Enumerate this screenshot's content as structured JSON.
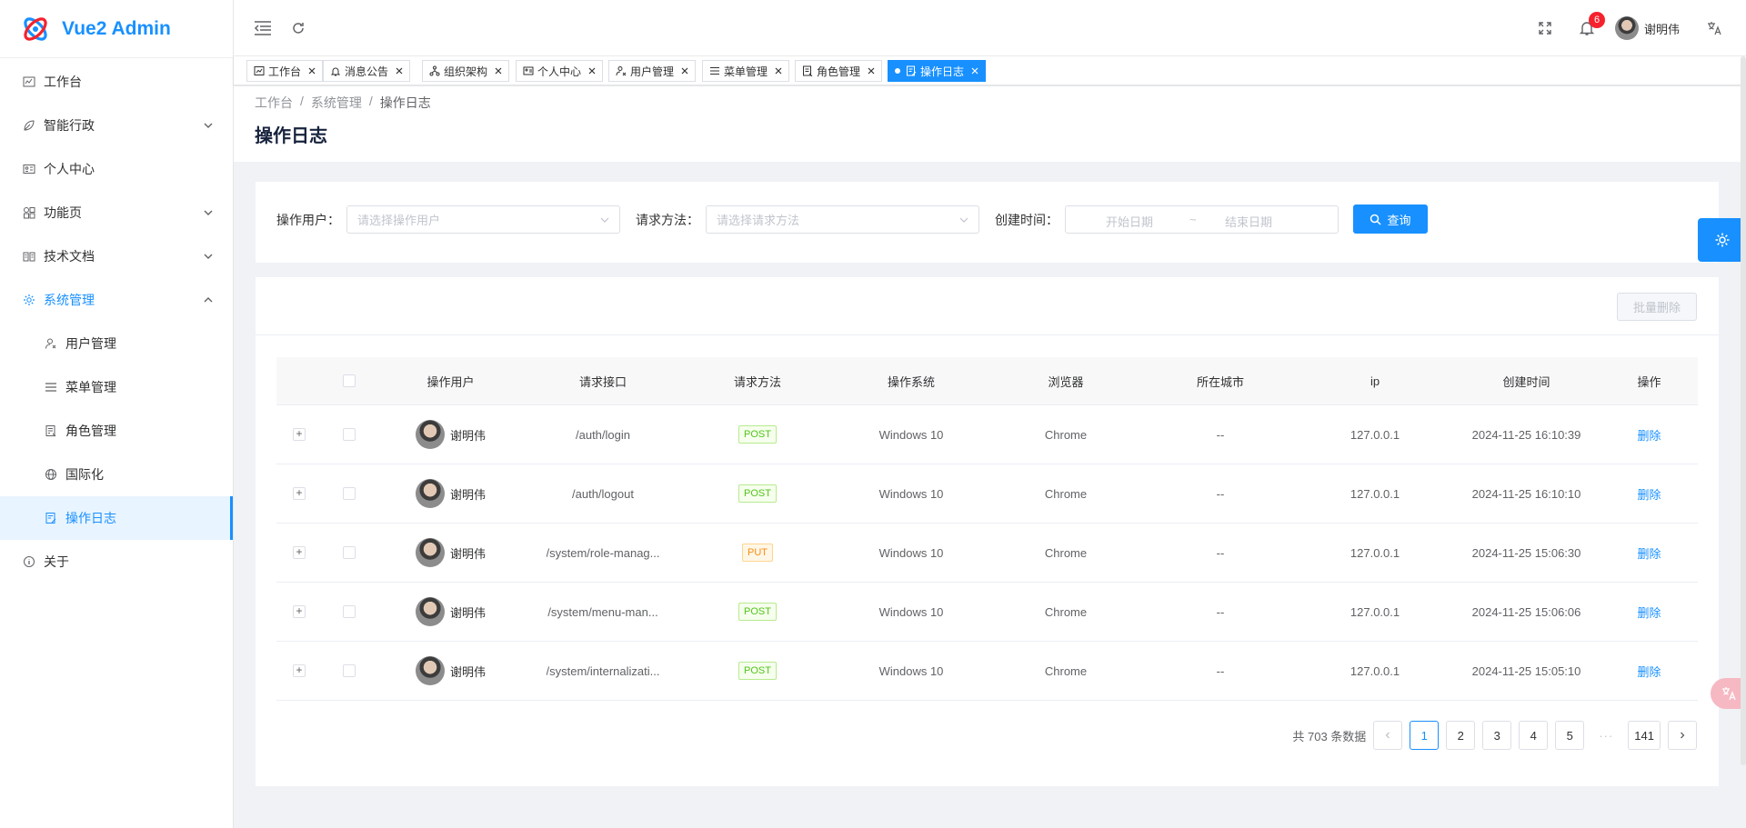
{
  "app": {
    "title": "Vue2 Admin"
  },
  "sidebar": {
    "items": [
      {
        "label": "工作台",
        "icon": "dashboard-icon"
      },
      {
        "label": "智能行政",
        "icon": "leaf-icon",
        "expandable": true
      },
      {
        "label": "个人中心",
        "icon": "id-card-icon"
      },
      {
        "label": "功能页",
        "icon": "apps-icon",
        "expandable": true
      },
      {
        "label": "技术文档",
        "icon": "book-icon",
        "expandable": true
      },
      {
        "label": "系统管理",
        "icon": "gear-icon",
        "expandable": true,
        "expanded": true
      }
    ],
    "sub_items": [
      {
        "label": "用户管理",
        "icon": "users-icon"
      },
      {
        "label": "菜单管理",
        "icon": "menu-icon"
      },
      {
        "label": "角色管理",
        "icon": "role-icon"
      },
      {
        "label": "国际化",
        "icon": "globe-icon"
      },
      {
        "label": "操作日志",
        "icon": "log-icon",
        "selected": true
      }
    ],
    "about": {
      "label": "关于",
      "icon": "info-icon"
    }
  },
  "header": {
    "notification_count": "6",
    "user_name": "谢明伟"
  },
  "tabs": [
    {
      "label": "工作台"
    },
    {
      "label": "消息公告"
    },
    {
      "label": "组织架构"
    },
    {
      "label": "个人中心"
    },
    {
      "label": "用户管理"
    },
    {
      "label": "菜单管理"
    },
    {
      "label": "角色管理"
    },
    {
      "label": "操作日志",
      "active": true
    }
  ],
  "breadcrumb": [
    "工作台",
    "系统管理",
    "操作日志"
  ],
  "page_title": "操作日志",
  "search": {
    "user_label": "操作用户：",
    "user_placeholder": "请选择操作用户",
    "method_label": "请求方法：",
    "method_placeholder": "请选择请求方法",
    "time_label": "创建时间：",
    "start_placeholder": "开始日期",
    "range_sep": "~",
    "end_placeholder": "结束日期",
    "query_button": "查询"
  },
  "toolbar": {
    "batch_delete": "批量删除"
  },
  "table": {
    "columns": [
      "操作用户",
      "请求接口",
      "请求方法",
      "操作系统",
      "浏览器",
      "所在城市",
      "ip",
      "创建时间",
      "操作"
    ],
    "rows": [
      {
        "user": "谢明伟",
        "api": "/auth/login",
        "method": "POST",
        "os": "Windows 10",
        "browser": "Chrome",
        "city": "--",
        "ip": "127.0.0.1",
        "time": "2024-11-25 16:10:39",
        "op": "删除"
      },
      {
        "user": "谢明伟",
        "api": "/auth/logout",
        "method": "POST",
        "os": "Windows 10",
        "browser": "Chrome",
        "city": "--",
        "ip": "127.0.0.1",
        "time": "2024-11-25 16:10:10",
        "op": "删除"
      },
      {
        "user": "谢明伟",
        "api": "/system/role-manag...",
        "method": "PUT",
        "os": "Windows 10",
        "browser": "Chrome",
        "city": "--",
        "ip": "127.0.0.1",
        "time": "2024-11-25 15:06:30",
        "op": "删除"
      },
      {
        "user": "谢明伟",
        "api": "/system/menu-man...",
        "method": "POST",
        "os": "Windows 10",
        "browser": "Chrome",
        "city": "--",
        "ip": "127.0.0.1",
        "time": "2024-11-25 15:06:06",
        "op": "删除"
      },
      {
        "user": "谢明伟",
        "api": "/system/internalizati...",
        "method": "POST",
        "os": "Windows 10",
        "browser": "Chrome",
        "city": "--",
        "ip": "127.0.0.1",
        "time": "2024-11-25 15:05:10",
        "op": "删除"
      }
    ]
  },
  "pagination": {
    "total_text": "共 703 条数据",
    "pages": [
      "1",
      "2",
      "3",
      "4",
      "5"
    ],
    "current": "1",
    "ellipsis": "···",
    "last": "141"
  },
  "colors": {
    "primary": "#1890ff",
    "post": "#52c41a",
    "put": "#fa8c16",
    "badge": "#f5222d"
  }
}
